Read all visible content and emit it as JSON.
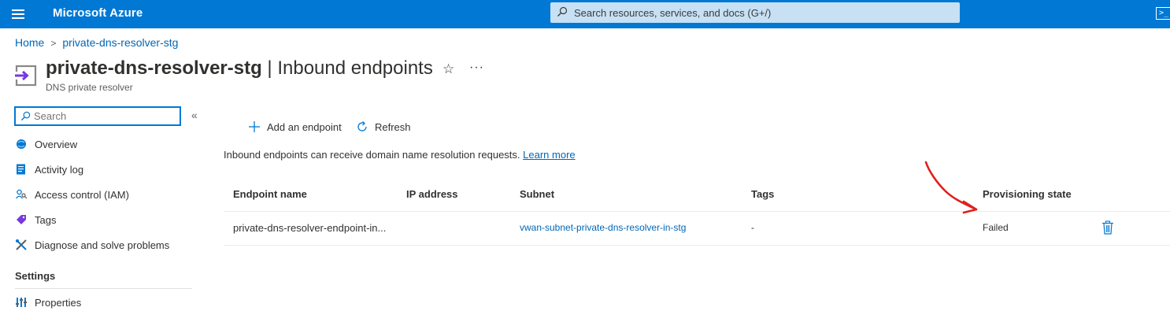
{
  "topbar": {
    "brand": "Microsoft Azure",
    "search_placeholder": "Search resources, services, and docs (G+/)",
    "icons": [
      "hamburger-icon",
      "search-icon",
      "cloud-shell-icon"
    ]
  },
  "breadcrumb": {
    "items": [
      "Home",
      "private-dns-resolver-stg"
    ]
  },
  "header": {
    "resource_name": "private-dns-resolver-stg",
    "separator": "|",
    "blade_title": "Inbound endpoints",
    "resource_type": "DNS private resolver",
    "favorite_icon": "☆",
    "more_icon": "···"
  },
  "nav": {
    "search_value": "",
    "search_placeholder": "Search",
    "collapse_glyph": "«",
    "items": [
      {
        "label": "Overview",
        "icon": "overview-icon"
      },
      {
        "label": "Activity log",
        "icon": "activity-log-icon"
      },
      {
        "label": "Access control (IAM)",
        "icon": "iam-icon"
      },
      {
        "label": "Tags",
        "icon": "tag-icon"
      },
      {
        "label": "Diagnose and solve problems",
        "icon": "diagnose-icon"
      }
    ],
    "settings_section": "Settings",
    "settings_items": [
      {
        "label": "Properties",
        "icon": "properties-icon"
      }
    ]
  },
  "toolbar": {
    "add_label": "Add an endpoint",
    "refresh_label": "Refresh"
  },
  "info": {
    "text": "Inbound endpoints can receive domain name resolution requests.",
    "link": "Learn more"
  },
  "table": {
    "columns": [
      "Endpoint name",
      "IP address",
      "Subnet",
      "Tags",
      "Provisioning state"
    ],
    "rows": [
      {
        "endpoint_name": "private-dns-resolver-endpoint-in...",
        "ip_address": "",
        "subnet": "vwan-subnet-private-dns-resolver-in-stg",
        "tags": "-",
        "provisioning_state": "Failed"
      }
    ]
  },
  "colors": {
    "azure_blue": "#0078d4",
    "link": "#0067b8",
    "annotation_red": "#e02020"
  }
}
